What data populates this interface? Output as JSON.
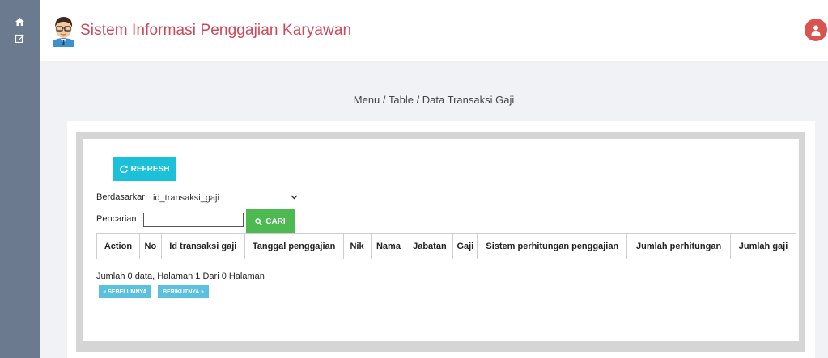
{
  "app": {
    "title": "Sistem Informasi Penggajian Karyawan"
  },
  "sidebar": {
    "items": [
      {
        "icon": "home-icon"
      },
      {
        "icon": "edit-icon"
      }
    ]
  },
  "breadcrumb": "Menu / Table / Data Transaksi Gaji",
  "toolbar": {
    "refresh_label": "REFRESH"
  },
  "filter": {
    "berdasarkan_label": "Berdasarkan:",
    "berdasarkan_value": "id_transaksi_gaji",
    "pencarian_label": "Pencarian",
    "colon": ":",
    "search_value": "",
    "cari_label": "CARI"
  },
  "table": {
    "headers": [
      "Action",
      "No",
      "Id transaksi gaji",
      "Tanggal penggajian",
      "Nik",
      "Nama",
      "Jabatan",
      "Gaji",
      "Sistem perhitungan penggajian",
      "Jumlah perhitungan",
      "Jumlah gaji"
    ],
    "rows": []
  },
  "pagination": {
    "info": "Jumlah 0 data, Halaman 1 Dari 0 Halaman",
    "prev_label": "« SEBELUMNYA",
    "next_label": "BERIKUTNYA »"
  },
  "colors": {
    "sidebar": "#6b7a8f",
    "title": "#d0475a",
    "refresh": "#1bc1d8",
    "cari": "#4cba50",
    "pagination": "#5bc0de",
    "user": "#d9534f"
  }
}
